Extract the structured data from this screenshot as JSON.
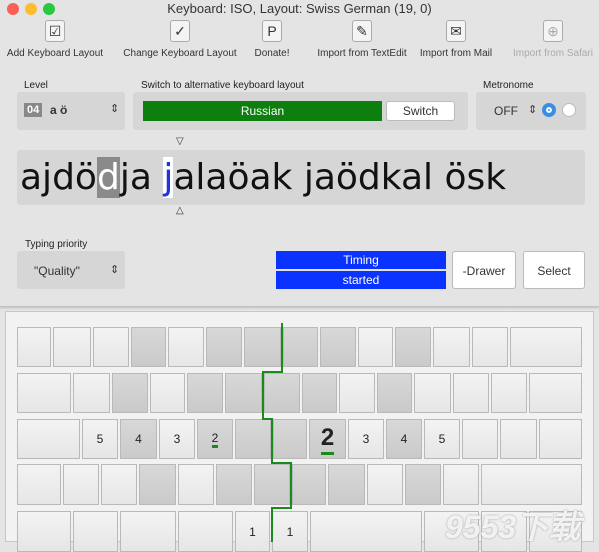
{
  "window": {
    "title": "Keyboard: ISO, Layout: Swiss German (19, 0)"
  },
  "toolbar": [
    {
      "label": "Add Keyboard Layout",
      "icon": "checkbox-icon",
      "enabled": true
    },
    {
      "label": "Change Keyboard Layout",
      "icon": "checkmark-icon",
      "enabled": true
    },
    {
      "label": "Donate!",
      "icon": "paypal-icon",
      "enabled": true
    },
    {
      "label": "Import from TextEdit",
      "icon": "textedit-icon",
      "enabled": true
    },
    {
      "label": "Import from Mail",
      "icon": "mail-icon",
      "enabled": true
    },
    {
      "label": "Import from Safari",
      "icon": "safari-icon",
      "enabled": false
    }
  ],
  "level": {
    "label": "Level",
    "number": "04",
    "chars": "a ö"
  },
  "switch_layout": {
    "label": "Switch to alternative keyboard layout",
    "layout": "Russian",
    "button": "Switch",
    "color": "#0e7f0e"
  },
  "metronome": {
    "label": "Metronome",
    "value": "OFF"
  },
  "text": {
    "before": "ajdö",
    "highlight": "d",
    "middle": "ja ",
    "cursor": "j",
    "after": "alaöak jaödkal ösk"
  },
  "typing_priority": {
    "label": "Typing priority",
    "value": "\"Quality\""
  },
  "timing": {
    "line1": "Timing",
    "line2": "started",
    "color": "#0a33ff"
  },
  "buttons": {
    "drawer": "-Drawer",
    "select": "Select"
  },
  "finger_labels": {
    "left": [
      "5",
      "4",
      "3",
      "2"
    ],
    "right": [
      "2",
      "3",
      "4",
      "5"
    ],
    "thumbs": [
      "1",
      "1"
    ]
  },
  "watermark": "9553下载"
}
